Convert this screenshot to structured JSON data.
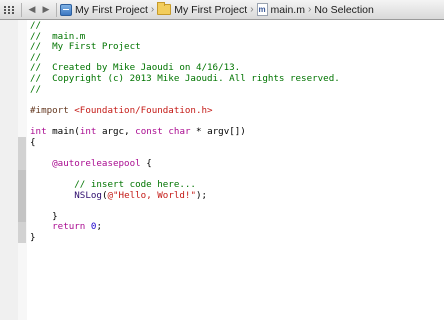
{
  "jumpbar": {
    "crumbs": [
      "My First Project",
      "My First Project",
      "main.m",
      "No Selection"
    ],
    "file_badge": "m"
  },
  "code_lines": [
    "//",
    "//  main.m",
    "//  My First Project",
    "//",
    "//  Created by Mike Jaoudi on 4/16/13.",
    "//  Copyright (c) 2013 Mike Jaoudi. All rights reserved.",
    "//",
    "",
    "#import <Foundation/Foundation.h>",
    "",
    "int main(int argc, const char * argv[])",
    "{",
    "",
    "    @autoreleasepool {",
    "",
    "        // insert code here...",
    "        NSLog(@\"Hello, World!\");",
    "",
    "    }",
    "    return 0;",
    "}"
  ]
}
